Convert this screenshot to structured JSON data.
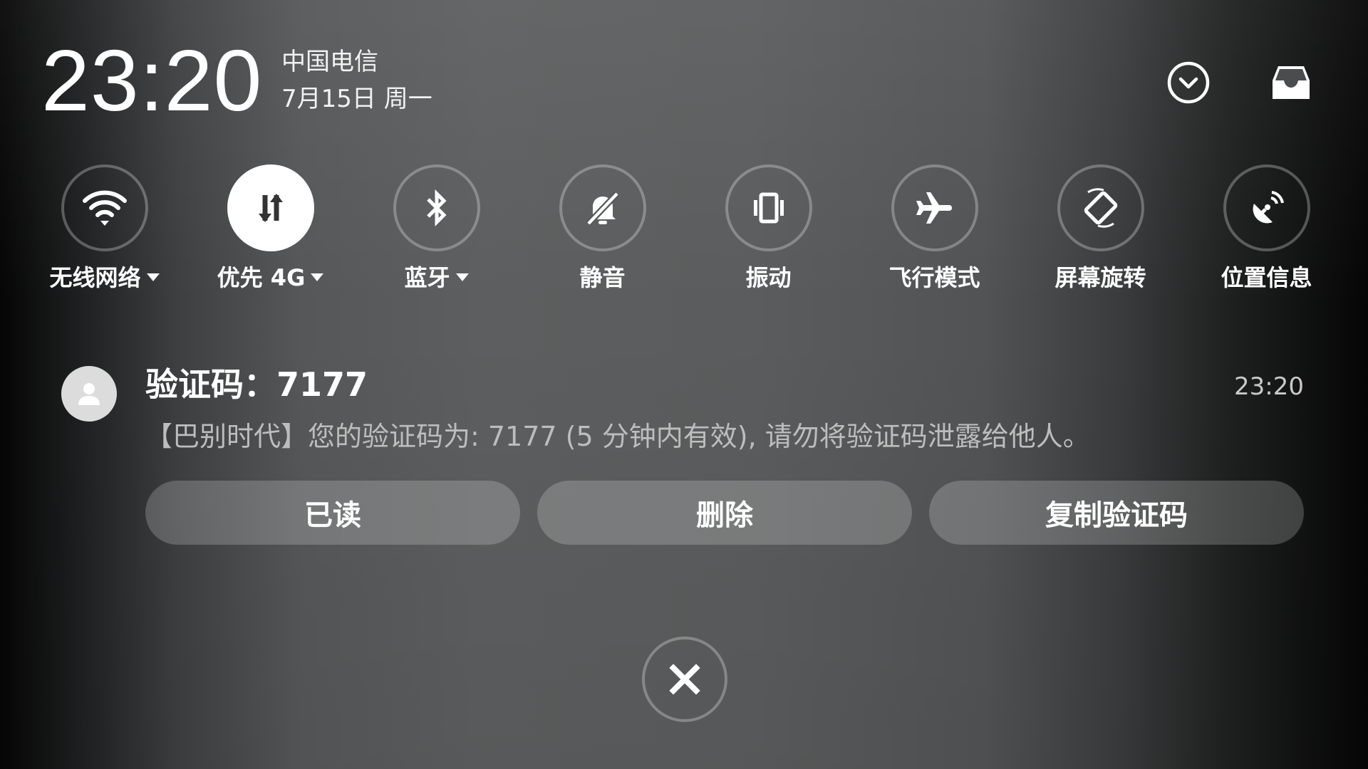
{
  "header": {
    "time": "23:20",
    "carrier": "中国电信",
    "date": "7月15日 周一",
    "expand_icon": "chevron-down-circle-icon",
    "inbox_icon": "inbox-tray-icon"
  },
  "toggles": [
    {
      "label": "无线网络",
      "icon": "wifi-icon",
      "active": false,
      "has_dropdown": true
    },
    {
      "label": "优先 4G",
      "icon": "mobile-data-icon",
      "active": true,
      "has_dropdown": true
    },
    {
      "label": "蓝牙",
      "icon": "bluetooth-icon",
      "active": false,
      "has_dropdown": true
    },
    {
      "label": "静音",
      "icon": "mute-bell-icon",
      "active": false,
      "has_dropdown": false
    },
    {
      "label": "振动",
      "icon": "vibrate-icon",
      "active": false,
      "has_dropdown": false
    },
    {
      "label": "飞行模式",
      "icon": "airplane-icon",
      "active": false,
      "has_dropdown": false
    },
    {
      "label": "屏幕旋转",
      "icon": "screen-rotation-icon",
      "active": false,
      "has_dropdown": false
    },
    {
      "label": "位置信息",
      "icon": "location-icon",
      "active": false,
      "has_dropdown": false
    }
  ],
  "notification": {
    "avatar_icon": "person-icon",
    "title": "验证码：7177",
    "time": "23:20",
    "body": "【巴别时代】您的验证码为: 7177 (5 分钟内有效), 请勿将验证码泄露给他人。",
    "actions": [
      "已读",
      "删除",
      "复制验证码"
    ]
  },
  "close_icon": "close-icon",
  "colors": {
    "active_toggle_bg": "#ffffff",
    "active_toggle_icon": "#333333",
    "ring": "#7a7a7a",
    "secondary_text": "#bdbdbd"
  }
}
